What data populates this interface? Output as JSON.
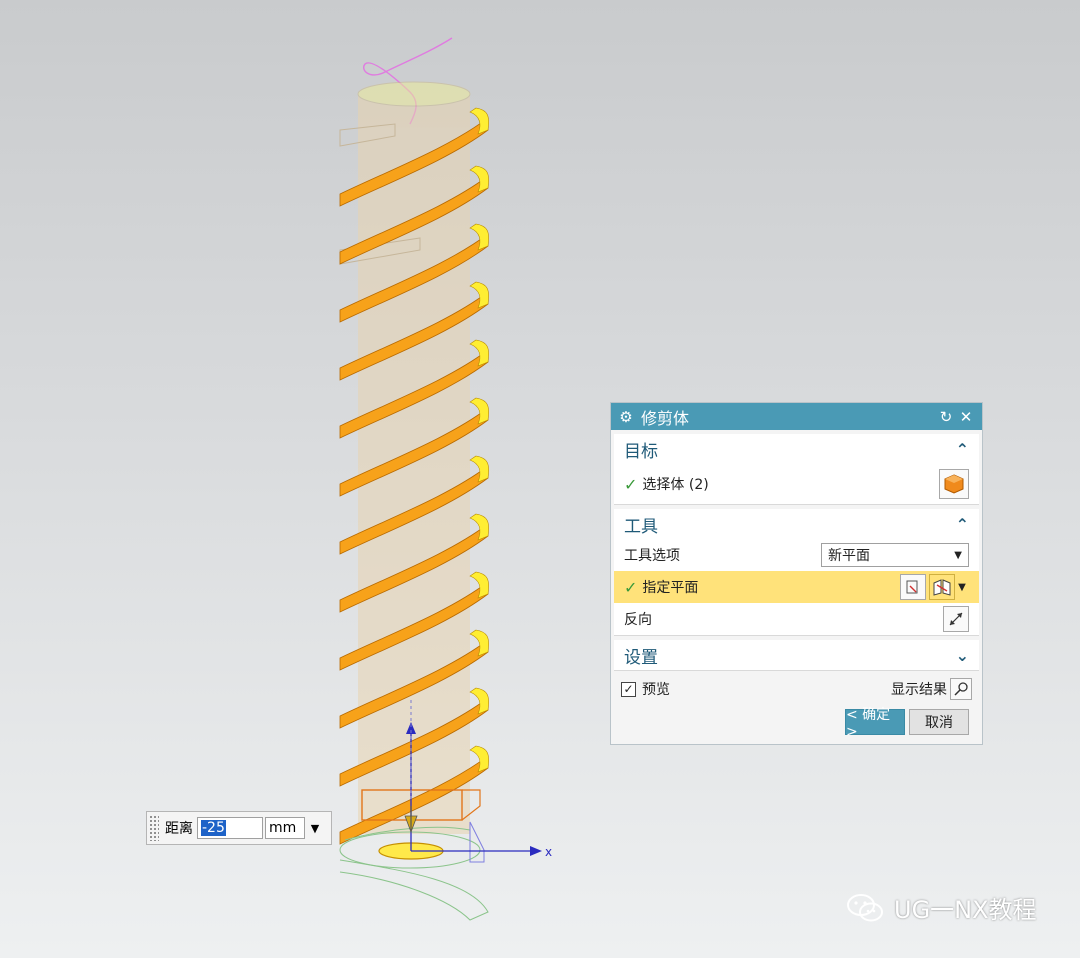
{
  "dialog": {
    "title": "修剪体",
    "reset_icon": "reset-icon",
    "close_icon": "close-icon",
    "sections": {
      "target": {
        "header": "目标",
        "select_body_label": "选择体 (2)"
      },
      "tool": {
        "header": "工具",
        "tool_option_label": "工具选项",
        "tool_option_value": "新平面",
        "specify_plane_label": "指定平面",
        "reverse_label": "反向"
      },
      "settings": {
        "header": "设置"
      }
    },
    "preview_label": "预览",
    "preview_checked": true,
    "show_result_label": "显示结果",
    "ok_label": "< 确定 >",
    "cancel_label": "取消"
  },
  "distance": {
    "label": "距离",
    "value": "-25",
    "unit": "mm"
  },
  "axis": {
    "x_label": "x"
  },
  "watermark": {
    "text": "UG一NX教程"
  },
  "colors": {
    "titlebar": "#4a9ab5",
    "highlight": "#ffe27a",
    "spring": "#f7a21a",
    "spring_face": "#ffee33",
    "cylinder": "#e8d3b0"
  }
}
